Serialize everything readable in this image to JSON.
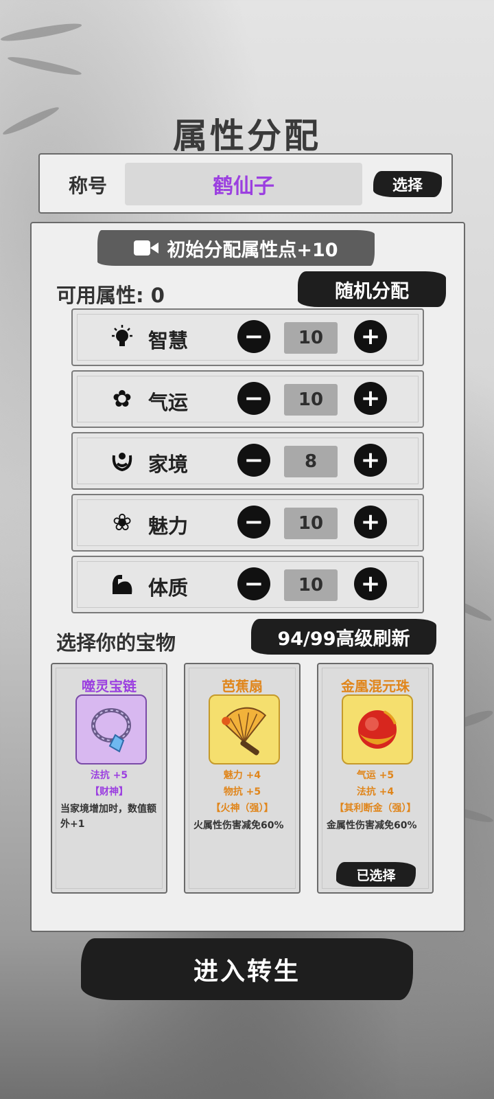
{
  "page": {
    "title": "属性分配"
  },
  "nickname": {
    "label": "称号",
    "value": "鹤仙子",
    "select_label": "选择"
  },
  "banner": {
    "icon": "video-camera-icon",
    "text": "初始分配属性点+10"
  },
  "available": {
    "text": "可用属性: 0"
  },
  "random_label": "随机分配",
  "attributes": [
    {
      "icon": "lightbulb-icon",
      "name": "智慧",
      "value": "10"
    },
    {
      "icon": "clover-icon",
      "name": "气运",
      "value": "10"
    },
    {
      "icon": "family-icon",
      "name": "家境",
      "value": "8"
    },
    {
      "icon": "flower-icon",
      "name": "魅力",
      "value": "10"
    },
    {
      "icon": "muscle-icon",
      "name": "体质",
      "value": "10"
    }
  ],
  "treasure": {
    "title": "选择你的宝物",
    "refresh_label": "94/99高级刷新",
    "cards": [
      {
        "name": "噬灵宝链",
        "icon": "chain-necklace-icon",
        "stat1": "法抗 +5",
        "stat2": "",
        "tag": "【财神】",
        "desc": "当家境增加时，数值额外+1",
        "color": "#9b3fe0"
      },
      {
        "name": "芭蕉扇",
        "icon": "fan-icon",
        "stat1": "魅力 +4",
        "stat2": "物抗 +5",
        "tag": "【火神（强）】",
        "desc": "火属性伤害减免60%",
        "color": "#e0851a"
      },
      {
        "name": "金凰混元珠",
        "icon": "red-orb-icon",
        "stat1": "气运 +5",
        "stat2": "法抗 +4",
        "tag": "【其利断金（强）】",
        "desc": "金属性伤害减免60%",
        "color": "#e0851a",
        "chosen_label": "已选择"
      }
    ]
  },
  "enter_label": "进入转生"
}
